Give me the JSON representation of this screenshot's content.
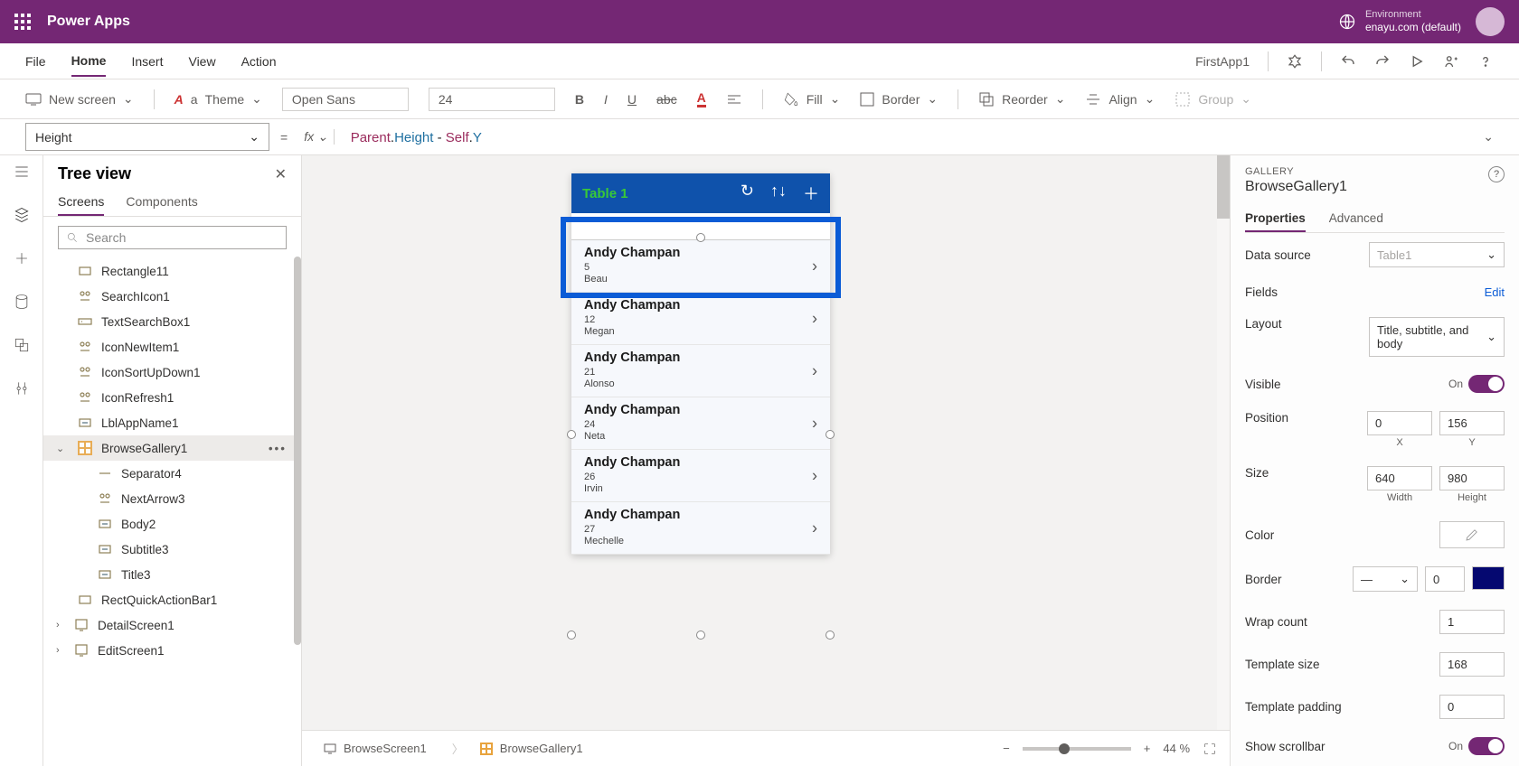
{
  "app_title": "Power Apps",
  "environment_label": "Environment",
  "environment_name": "enayu.com (default)",
  "menu": [
    "File",
    "Home",
    "Insert",
    "View",
    "Action"
  ],
  "menu_active": "Home",
  "app_name": "FirstApp1",
  "ribbon": {
    "new_screen": "New screen",
    "theme": "Theme",
    "font": "Open Sans",
    "font_size": "24",
    "fill": "Fill",
    "border": "Border",
    "reorder": "Reorder",
    "align": "Align",
    "group": "Group"
  },
  "formula": {
    "property": "Height",
    "expression_tokens": [
      "Parent",
      ".",
      "Height",
      " - ",
      "Self",
      ".",
      "Y"
    ]
  },
  "tree": {
    "title": "Tree view",
    "tabs": [
      "Screens",
      "Components"
    ],
    "tabs_active": "Screens",
    "search_placeholder": "Search",
    "items": [
      {
        "name": "Rectangle11",
        "kind": "rect",
        "depth": 0
      },
      {
        "name": "SearchIcon1",
        "kind": "icon",
        "depth": 0
      },
      {
        "name": "TextSearchBox1",
        "kind": "input",
        "depth": 0
      },
      {
        "name": "IconNewItem1",
        "kind": "icon",
        "depth": 0
      },
      {
        "name": "IconSortUpDown1",
        "kind": "icon",
        "depth": 0
      },
      {
        "name": "IconRefresh1",
        "kind": "icon",
        "depth": 0
      },
      {
        "name": "LblAppName1",
        "kind": "label",
        "depth": 0
      },
      {
        "name": "BrowseGallery1",
        "kind": "gallery",
        "depth": 0,
        "selected": true,
        "expandable": true
      },
      {
        "name": "Separator4",
        "kind": "sep",
        "depth": 1
      },
      {
        "name": "NextArrow3",
        "kind": "icon",
        "depth": 1
      },
      {
        "name": "Body2",
        "kind": "label",
        "depth": 1
      },
      {
        "name": "Subtitle3",
        "kind": "label",
        "depth": 1
      },
      {
        "name": "Title3",
        "kind": "label",
        "depth": 1
      },
      {
        "name": "RectQuickActionBar1",
        "kind": "rect",
        "depth": 0
      },
      {
        "name": "DetailScreen1",
        "kind": "screen",
        "depth": -1,
        "expandable": true
      },
      {
        "name": "EditScreen1",
        "kind": "screen",
        "depth": -1,
        "expandable": true
      }
    ]
  },
  "phone": {
    "title": "Table 1",
    "items": [
      {
        "title": "Andy Champan",
        "sub1": "5",
        "sub2": "Beau"
      },
      {
        "title": "Andy Champan",
        "sub1": "12",
        "sub2": "Megan"
      },
      {
        "title": "Andy Champan",
        "sub1": "21",
        "sub2": "Alonso"
      },
      {
        "title": "Andy Champan",
        "sub1": "24",
        "sub2": "Neta"
      },
      {
        "title": "Andy Champan",
        "sub1": "26",
        "sub2": "Irvin"
      },
      {
        "title": "Andy Champan",
        "sub1": "27",
        "sub2": "Mechelle"
      }
    ]
  },
  "breadcrumbs": [
    "BrowseScreen1",
    "BrowseGallery1"
  ],
  "zoom": "44",
  "props": {
    "caption": "GALLERY",
    "name": "BrowseGallery1",
    "tabs": [
      "Properties",
      "Advanced"
    ],
    "tabs_active": "Properties",
    "data_source_label": "Data source",
    "data_source_value": "Table1",
    "fields_label": "Fields",
    "fields_action": "Edit",
    "layout_label": "Layout",
    "layout_value": "Title, subtitle, and body",
    "visible_label": "Visible",
    "visible_state": "On",
    "position_label": "Position",
    "pos_x": "0",
    "pos_y": "156",
    "pos_x_lab": "X",
    "pos_y_lab": "Y",
    "size_label": "Size",
    "size_w": "640",
    "size_h": "980",
    "size_w_lab": "Width",
    "size_h_lab": "Height",
    "color_label": "Color",
    "border_label": "Border",
    "border_width": "0",
    "wrap_label": "Wrap count",
    "wrap_value": "1",
    "tpl_size_label": "Template size",
    "tpl_size_value": "168",
    "tpl_pad_label": "Template padding",
    "tpl_pad_value": "0",
    "scroll_label": "Show scrollbar",
    "scroll_state": "On"
  }
}
